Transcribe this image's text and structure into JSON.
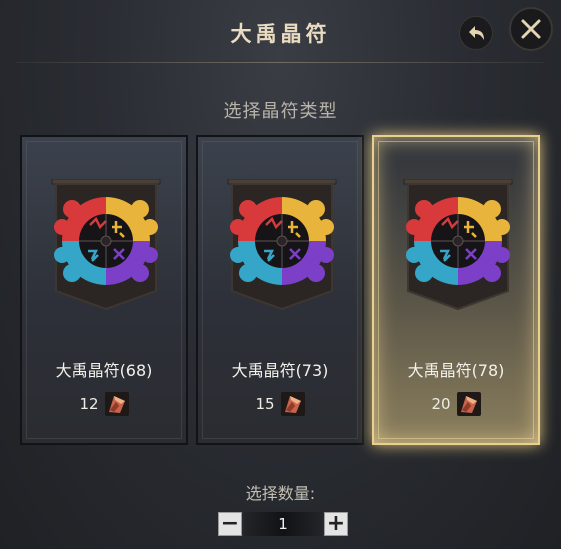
{
  "header": {
    "title": "大禹晶符"
  },
  "subtitle": "选择晶符类型",
  "cards": [
    {
      "name": "大禹晶符(68)",
      "cost": "12",
      "selected": false
    },
    {
      "name": "大禹晶符(73)",
      "cost": "15",
      "selected": false
    },
    {
      "name": "大禹晶符(78)",
      "cost": "20",
      "selected": true
    }
  ],
  "quantity": {
    "label": "选择数量:",
    "value": "1",
    "minus": "−",
    "plus": "+"
  },
  "icons": {
    "back": "return-arrow-icon",
    "close": "close-icon",
    "emblem": "crystal-talisman-emblem-icon",
    "cost": "material-shard-icon"
  },
  "colors": {
    "title": "#e9dcc0",
    "selected_border": "#e9d08f"
  }
}
